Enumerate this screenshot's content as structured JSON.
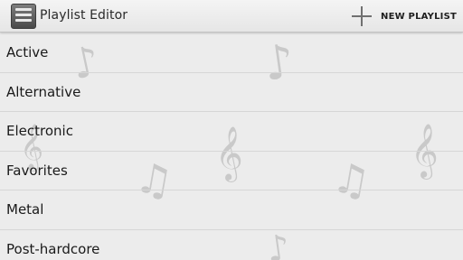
{
  "header": {
    "app_icon": "playlist-icon",
    "title": "Playlist Editor",
    "action_icon": "plus-icon",
    "action_label": "NEW PLAYLIST"
  },
  "background": {
    "watermark_icons": [
      "music-note-icon",
      "treble-clef-icon"
    ]
  },
  "playlists": [
    {
      "label": "Active"
    },
    {
      "label": "Alternative"
    },
    {
      "label": "Electronic"
    },
    {
      "label": "Favorites"
    },
    {
      "label": "Metal"
    },
    {
      "label": "Post-hardcore"
    }
  ],
  "colors": {
    "background": "#ececec",
    "header": "#eeeeee",
    "divider": "#d6d6d6",
    "text": "#1a1a1a"
  }
}
